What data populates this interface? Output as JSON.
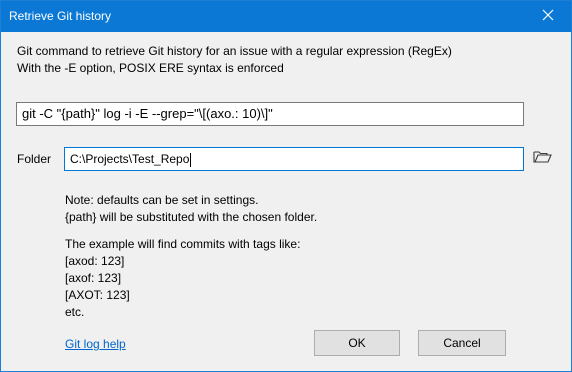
{
  "window": {
    "title": "Retrieve Git history",
    "close_icon": "close-icon"
  },
  "description": {
    "line1": "Git command to retrieve Git history for an issue with a regular expression (RegEx)",
    "line2": "With the -E option, POSIX ERE syntax is enforced"
  },
  "command": {
    "value": "git -C \"{path}\" log -i -E --grep=\"\\[(axo.: 10)\\]\""
  },
  "folder": {
    "label": "Folder",
    "value": "C:\\Projects\\Test_Repo",
    "browse_icon": "open-folder-icon"
  },
  "note": {
    "line1": "Note: defaults can be set in settings.",
    "line2": "{path} will be substituted with the chosen folder."
  },
  "example": {
    "intro": "The example will find commits with tags like:",
    "items": [
      "[axod: 123]",
      "[axof: 123]",
      "[AXOT: 123]",
      "etc."
    ]
  },
  "help_link": "Git log help",
  "buttons": {
    "ok": "OK",
    "cancel": "Cancel"
  }
}
